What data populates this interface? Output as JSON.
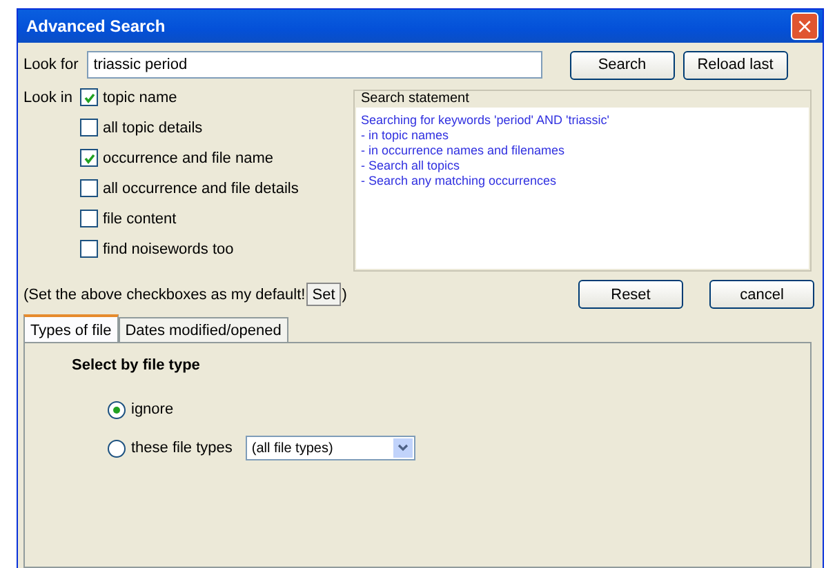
{
  "window": {
    "title": "Advanced Search",
    "close": "×"
  },
  "look_for": {
    "label": "Look for",
    "value": "triassic period"
  },
  "buttons_top": [
    "Search",
    "Reload last"
  ],
  "look_in": {
    "label": "Look in",
    "options": [
      {
        "label": "topic name",
        "checked": true
      },
      {
        "label": "all topic details",
        "checked": false
      },
      {
        "label": "occurrence and file name",
        "checked": true
      },
      {
        "label": "all occurrence and file details",
        "checked": false
      },
      {
        "label": "file content",
        "checked": false
      },
      {
        "label": "find noisewords too",
        "checked": false
      }
    ]
  },
  "search_statement": {
    "title": "Search statement",
    "lines": [
      "Searching for keywords 'period' AND 'triassic'",
      "- in topic names",
      "- in occurrence names and filenames",
      "- Search all topics",
      "- Search any matching occurrences"
    ]
  },
  "default_note": {
    "before": "(Set the above checkboxes as my default!",
    "button": "Set",
    "after": ")"
  },
  "buttons_bottom": [
    "Reset",
    "cancel"
  ],
  "tabs": [
    {
      "label": "Types of file",
      "selected": true
    },
    {
      "label": "Dates modified/opened",
      "selected": false
    }
  ],
  "file_type": {
    "heading": "Select by file type",
    "options": [
      {
        "label": "ignore",
        "selected": true
      },
      {
        "label": "these file types",
        "selected": false
      }
    ],
    "dropdown": "(all file types)"
  }
}
